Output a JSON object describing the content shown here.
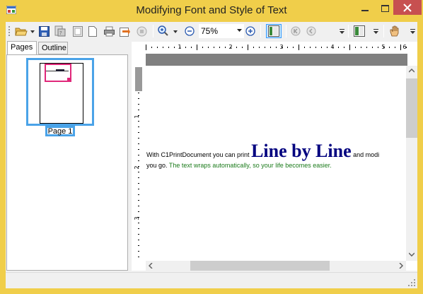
{
  "window": {
    "title": "Modifying Font and Style of Text",
    "minimize_icon": "minimize-icon",
    "maximize_icon": "maximize-icon",
    "close_icon": "close-icon"
  },
  "toolbar": {
    "zoom_value": "75%",
    "icons": [
      "open-icon",
      "save-icon",
      "page-setup-icon",
      "single-page-icon",
      "page-icon",
      "print-icon",
      "export-icon",
      "stop-icon",
      "zoom-in-icon",
      "zoom-out-icon",
      "zoom-plus-icon",
      "thumbnails-toggle-icon",
      "first-page-icon",
      "previous-page-icon",
      "continuous-view-icon",
      "hand-tool-icon"
    ]
  },
  "tabs": [
    {
      "label": "Pages",
      "active": true
    },
    {
      "label": "Outline",
      "active": false
    }
  ],
  "thumbnails": [
    {
      "label": "Page 1",
      "selected": true
    }
  ],
  "ruler": {
    "h_labels": [
      "1",
      "2",
      "3",
      "4",
      "5",
      "6"
    ],
    "v_labels": [
      "1",
      "2",
      "3"
    ]
  },
  "document": {
    "line1_before": "With C1PrintDocument you can print ",
    "big": "Line by Line",
    "line1_after": " and modi",
    "line2_plain": "you go. ",
    "line2_green": "The text wraps automatically, so your life becomes easier."
  },
  "colors": {
    "title_bar": "#f0ce4a",
    "close_button": "#c75050",
    "selection": "#4aa3e8",
    "thumb_highlight": "#e0287a",
    "big_text": "#00007f",
    "green_text": "#1a7a1a"
  }
}
